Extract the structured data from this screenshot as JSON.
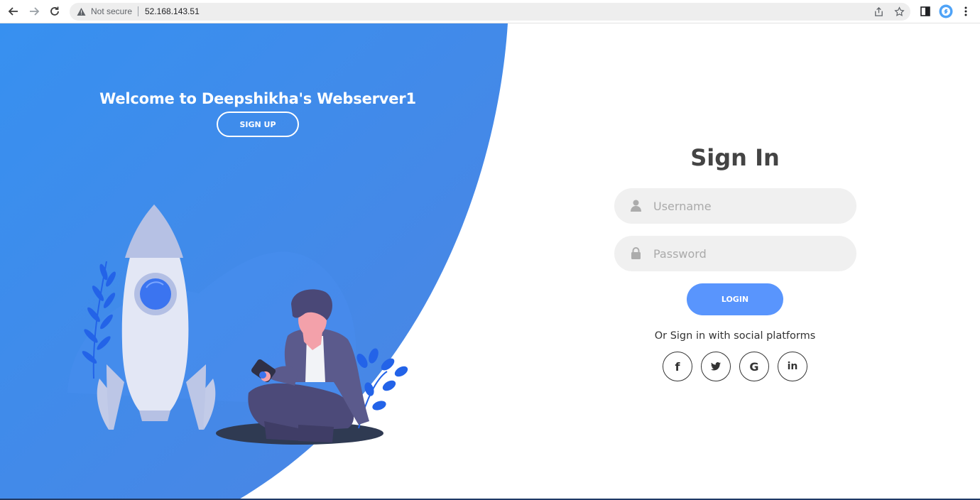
{
  "browser": {
    "security_label": "Not secure",
    "url": "52.168.143.51"
  },
  "hero": {
    "welcome_text": "Welcome to Deepshikha's Webserver1",
    "signup_label": "SIGN UP"
  },
  "signin": {
    "title": "Sign In",
    "username_placeholder": "Username",
    "password_placeholder": "Password",
    "login_label": "LOGIN",
    "social_text": "Or Sign in with social platforms",
    "social": [
      {
        "name": "facebook",
        "glyph": "f"
      },
      {
        "name": "twitter",
        "glyph": ""
      },
      {
        "name": "google",
        "glyph": "G"
      },
      {
        "name": "linkedin",
        "glyph": "in"
      }
    ]
  },
  "colors": {
    "primary_blue": "#4d84e2",
    "accent_blue": "#5995fd",
    "input_bg": "#f0f0f0"
  }
}
